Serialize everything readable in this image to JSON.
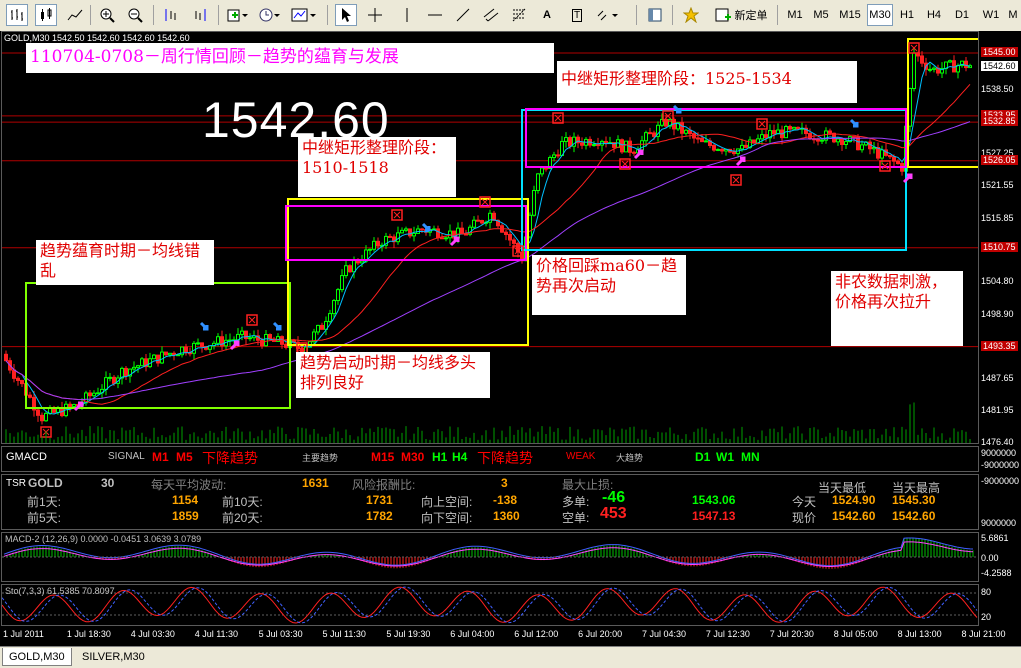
{
  "toolbar": {
    "new_order": "新定单",
    "timeframes": [
      "M1",
      "M5",
      "M15",
      "M30",
      "H1",
      "H4",
      "D1",
      "W1"
    ],
    "active_timeframe": "M30"
  },
  "chart": {
    "symbol_header": "GOLD,M30  1542.50 1542.60 1542.60 1542.60",
    "big_price": "1542.60",
    "title": "110704-0708－周行情回顾－趋势的蕴育与发展",
    "annotations": {
      "box1": "中继矩形整理阶段：1525-1534",
      "box2": "中继矩形整理阶段：1510-1518",
      "box3": "趋势蕴育时期－均线错乱",
      "box4": "价格回踩ma60－趋势再次启动",
      "box5": "趋势启动时期－均线多头排列良好",
      "box6": "非农数据刺激，价格再次拉升"
    },
    "price_scale": [
      "1545.00",
      "1542.60",
      "1538.50",
      "1533.95",
      "1532.85",
      "1527.25",
      "1526.05",
      "1521.55",
      "1515.85",
      "1510.75",
      "1504.80",
      "1498.90",
      "1493.35",
      "1487.65",
      "1481.95",
      "1476.40"
    ],
    "price_tags": [
      {
        "text": "1545.00",
        "color": "#c00000"
      },
      {
        "text": "1542.60",
        "color": "#ffffff"
      },
      {
        "text": "1533.95",
        "color": "#c00000"
      },
      {
        "text": "1532.85",
        "color": "#c00000"
      },
      {
        "text": "1526.05",
        "color": "#c00000"
      },
      {
        "text": "1510.75",
        "color": "#c00000"
      },
      {
        "text": "1493.35",
        "color": "#c00000"
      }
    ],
    "time_labels": [
      "1 Jul 2011",
      "1 Jul 18:30",
      "4 Jul 03:30",
      "4 Jul 11:30",
      "5 Jul 03:30",
      "5 Jul 11:30",
      "5 Jul 19:30",
      "6 Jul 04:00",
      "6 Jul 12:00",
      "6 Jul 20:00",
      "7 Jul 04:30",
      "7 Jul 12:30",
      "7 Jul 20:30",
      "8 Jul 05:00",
      "8 Jul 13:00",
      "8 Jul 21:00"
    ]
  },
  "gmacd": {
    "name": "GMACD",
    "signal_label": "SIGNAL",
    "m1": "M1",
    "m5": "M5",
    "trend1": "下降趋势",
    "main_trend": "主要趋势",
    "m15": "M15",
    "m30": "M30",
    "h1": "H1",
    "h4": "H4",
    "trend2": "下降趋势",
    "weak": "WEAK",
    "big_trend": "大趋势",
    "d1": "D1",
    "w1": "W1",
    "mn": "MN",
    "scale": [
      "9000000",
      "-9000000"
    ]
  },
  "tsr": {
    "name": "TSR",
    "symbol": "GOLD",
    "period": "30",
    "avg_label": "每天平均波动:",
    "avg_value": "1631",
    "risk_label": "风险报酬比:",
    "risk_value": "3",
    "max_stop_label": "最大止损:",
    "prev1_label": "前1天:",
    "prev1": "1154",
    "prev5_label": "前5天:",
    "prev5": "1859",
    "prev10_label": "前10天:",
    "prev10": "1731",
    "prev20_label": "前20天:",
    "prev20": "1782",
    "up_space_label": "向上空间:",
    "up_space": "-138",
    "down_space_label": "向下空间:",
    "down_space": "1360",
    "long_label": "多单:",
    "long_value": "-46",
    "long_price": "1543.06",
    "short_label": "空单:",
    "short_value": "453",
    "short_price": "1547.13",
    "today_low_label": "当天最低",
    "today_high_label": "当天最高",
    "today_label": "今天",
    "today_low": "1524.90",
    "today_high": "1545.30",
    "now_label": "现价",
    "now_low": "1542.60",
    "now_high": "1542.60",
    "scale": [
      "-9000000",
      "9000000"
    ]
  },
  "macd": {
    "header": "MACD-2 (12,26,9) 0.0000 -0.0451 3.0639 3.0789",
    "scale": [
      "5.6861",
      "0.00",
      "-4.2588"
    ]
  },
  "sto": {
    "header": "Sto(7,3,3) 61.5385 70.8097",
    "scale": [
      "80",
      "20"
    ]
  },
  "tabs": [
    "GOLD,M30",
    "SILVER,M30"
  ],
  "active_tab": "GOLD,M30"
}
